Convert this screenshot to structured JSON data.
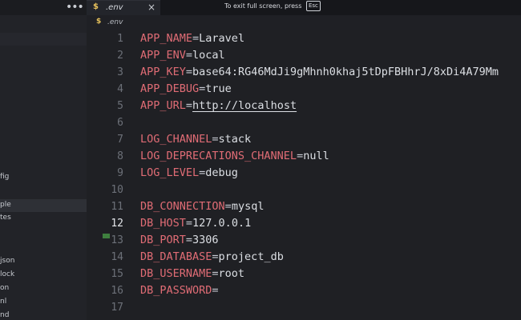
{
  "topbar": {
    "more_icon": "ellipsis-icon",
    "tab": {
      "icon_text": "$",
      "label": ".env",
      "close": "×"
    },
    "fullscreen_hint": {
      "text": "To exit full screen, press",
      "key": "Esc"
    }
  },
  "breadcrumb": {
    "icon_text": "$",
    "label": ".env"
  },
  "sidebar": {
    "items": [
      {
        "label": "fig"
      },
      {
        "label": "ple"
      },
      {
        "label": "tes"
      },
      {
        "label": "json"
      },
      {
        "label": "lock"
      },
      {
        "label": "on"
      },
      {
        "label": "nl"
      },
      {
        "label": "nd"
      }
    ]
  },
  "editor": {
    "active_line": 12,
    "lines": [
      {
        "n": "1",
        "key": "APP_NAME",
        "eq": "=",
        "val": "Laravel"
      },
      {
        "n": "2",
        "key": "APP_ENV",
        "eq": "=",
        "val": "local"
      },
      {
        "n": "3",
        "key": "APP_KEY",
        "eq": "=",
        "val": "base64:RG46MdJi9gMhnh0khaj5tDpFBHhrJ/8xDi4A79Mm"
      },
      {
        "n": "4",
        "key": "APP_DEBUG",
        "eq": "=",
        "val": "true"
      },
      {
        "n": "5",
        "key": "APP_URL",
        "eq": "=",
        "val": "http://localhost"
      },
      {
        "n": "6",
        "key": "",
        "eq": "",
        "val": ""
      },
      {
        "n": "7",
        "key": "LOG_CHANNEL",
        "eq": "=",
        "val": "stack"
      },
      {
        "n": "8",
        "key": "LOG_DEPRECATIONS_CHANNEL",
        "eq": "=",
        "val": "null"
      },
      {
        "n": "9",
        "key": "LOG_LEVEL",
        "eq": "=",
        "val": "debug"
      },
      {
        "n": "10",
        "key": "",
        "eq": "",
        "val": ""
      },
      {
        "n": "11",
        "key": "DB_CONNECTION",
        "eq": "=",
        "val": "mysql"
      },
      {
        "n": "12",
        "key": "DB_HOST",
        "eq": "=",
        "val": "127.0.0.1"
      },
      {
        "n": "13",
        "key": "DB_PORT",
        "eq": "=",
        "val": "3306"
      },
      {
        "n": "14",
        "key": "DB_DATABASE",
        "eq": "=",
        "val": "project_db"
      },
      {
        "n": "15",
        "key": "DB_USERNAME",
        "eq": "=",
        "val": "root"
      },
      {
        "n": "16",
        "key": "DB_PASSWORD",
        "eq": "=",
        "val": ""
      },
      {
        "n": "17",
        "key": "",
        "eq": "",
        "val": ""
      }
    ]
  },
  "colors": {
    "key": "#e06c75",
    "value": "#dcdfe4",
    "env_icon": "#e6c15c",
    "background": "#1f2024"
  }
}
